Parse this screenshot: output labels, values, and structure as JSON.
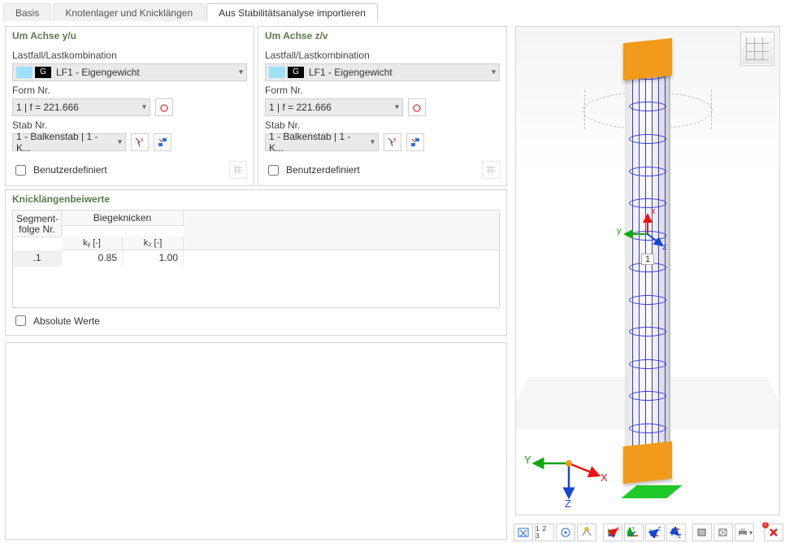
{
  "tabs": [
    {
      "label": "Basis",
      "active": false
    },
    {
      "label": "Knotenlager und Knicklängen",
      "active": false
    },
    {
      "label": "Aus Stabilitätsanalyse importieren",
      "active": true
    }
  ],
  "axisGroups": {
    "yu": {
      "title": "Um Achse y/u",
      "loadLabel": "Lastfall/Lastkombination",
      "loadBadgeLetter": "G",
      "loadValue": "LF1 - Eigengewicht",
      "formLabel": "Form Nr.",
      "formValue": "1 | f = 221.666",
      "stabLabel": "Stab Nr.",
      "stabValue": "1 - Balkenstab | 1 - K...",
      "userDefined": "Benutzerdefiniert"
    },
    "zv": {
      "title": "Um Achse z/v",
      "loadLabel": "Lastfall/Lastkombination",
      "loadBadgeLetter": "G",
      "loadValue": "LF1 - Eigengewicht",
      "formLabel": "Form Nr.",
      "formValue": "1 | f = 221.666",
      "stabLabel": "Stab Nr.",
      "stabValue": "1 - Balkenstab | 1 - K...",
      "userDefined": "Benutzerdefiniert"
    }
  },
  "klb": {
    "title": "Knicklängenbeiwerte",
    "headers": {
      "segCol": "Segment-\nfolge Nr.",
      "group": "Biegeknicken",
      "ky": "kᵧ [-]",
      "kz": "k₂ [-]"
    },
    "row": {
      "seg": ".1",
      "ky": "0.85",
      "kz": "1.00"
    },
    "absLabel": "Absolute Werte"
  },
  "viewport": {
    "axes": {
      "x": "X",
      "y": "Y",
      "z": "Z"
    },
    "axesSmall": {
      "x": "x",
      "y": "y",
      "z": "z"
    },
    "columnLabel": "1"
  },
  "icons": {
    "moment": "moment-icon",
    "pointerX": "pointer-x-icon",
    "assignBeam": "assign-beam-icon",
    "mesh": "mesh-icon"
  },
  "toolbar": {
    "items": [
      "reset-view",
      "numbers-123",
      "isometric",
      "perspective",
      "align-x",
      "align-y",
      "align-z",
      "align-neg-z",
      "solid-cube",
      "wire-cube",
      "print",
      "remove"
    ],
    "label123": "1 2 3"
  }
}
